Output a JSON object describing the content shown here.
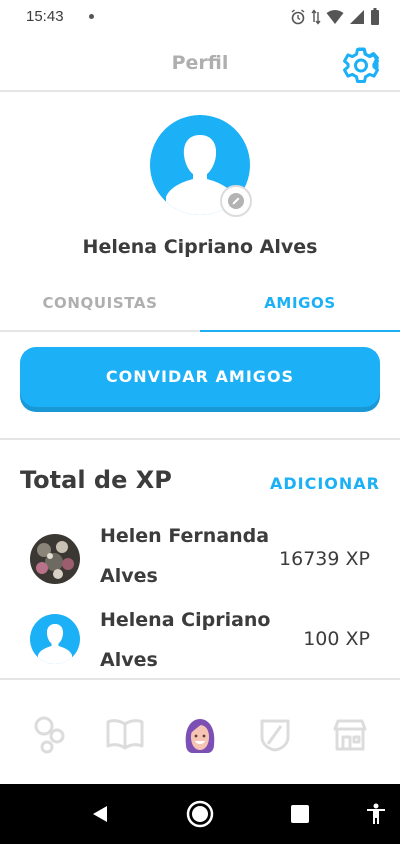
{
  "status_bar": {
    "time": "15:43"
  },
  "header": {
    "title": "Perfil"
  },
  "profile": {
    "name": "Helena Cipriano Alves"
  },
  "tabs": [
    {
      "label": "CONQUISTAS",
      "active": false
    },
    {
      "label": "AMIGOS",
      "active": true
    }
  ],
  "invite_button": {
    "label": "CONVIDAR AMIGOS"
  },
  "xp_section": {
    "title": "Total de XP",
    "add_label": "ADICIONAR",
    "friends": [
      {
        "name": "Helen Fernanda Alves",
        "xp": "16739 XP",
        "avatar": "photo"
      },
      {
        "name": "Helena Cipriano Alves",
        "xp": "100 XP",
        "avatar": "default"
      }
    ]
  },
  "bottom_nav": [
    {
      "icon": "stories-icon",
      "active": false
    },
    {
      "icon": "learn-icon",
      "active": false
    },
    {
      "icon": "profile-icon",
      "active": true
    },
    {
      "icon": "leagues-icon",
      "active": false
    },
    {
      "icon": "shop-icon",
      "active": false
    }
  ],
  "colors": {
    "accent": "#1cb0f6",
    "accent_shadow": "#1899d6",
    "text": "#3c3c3c",
    "muted": "#afafaf",
    "divider": "#e5e5e5"
  }
}
